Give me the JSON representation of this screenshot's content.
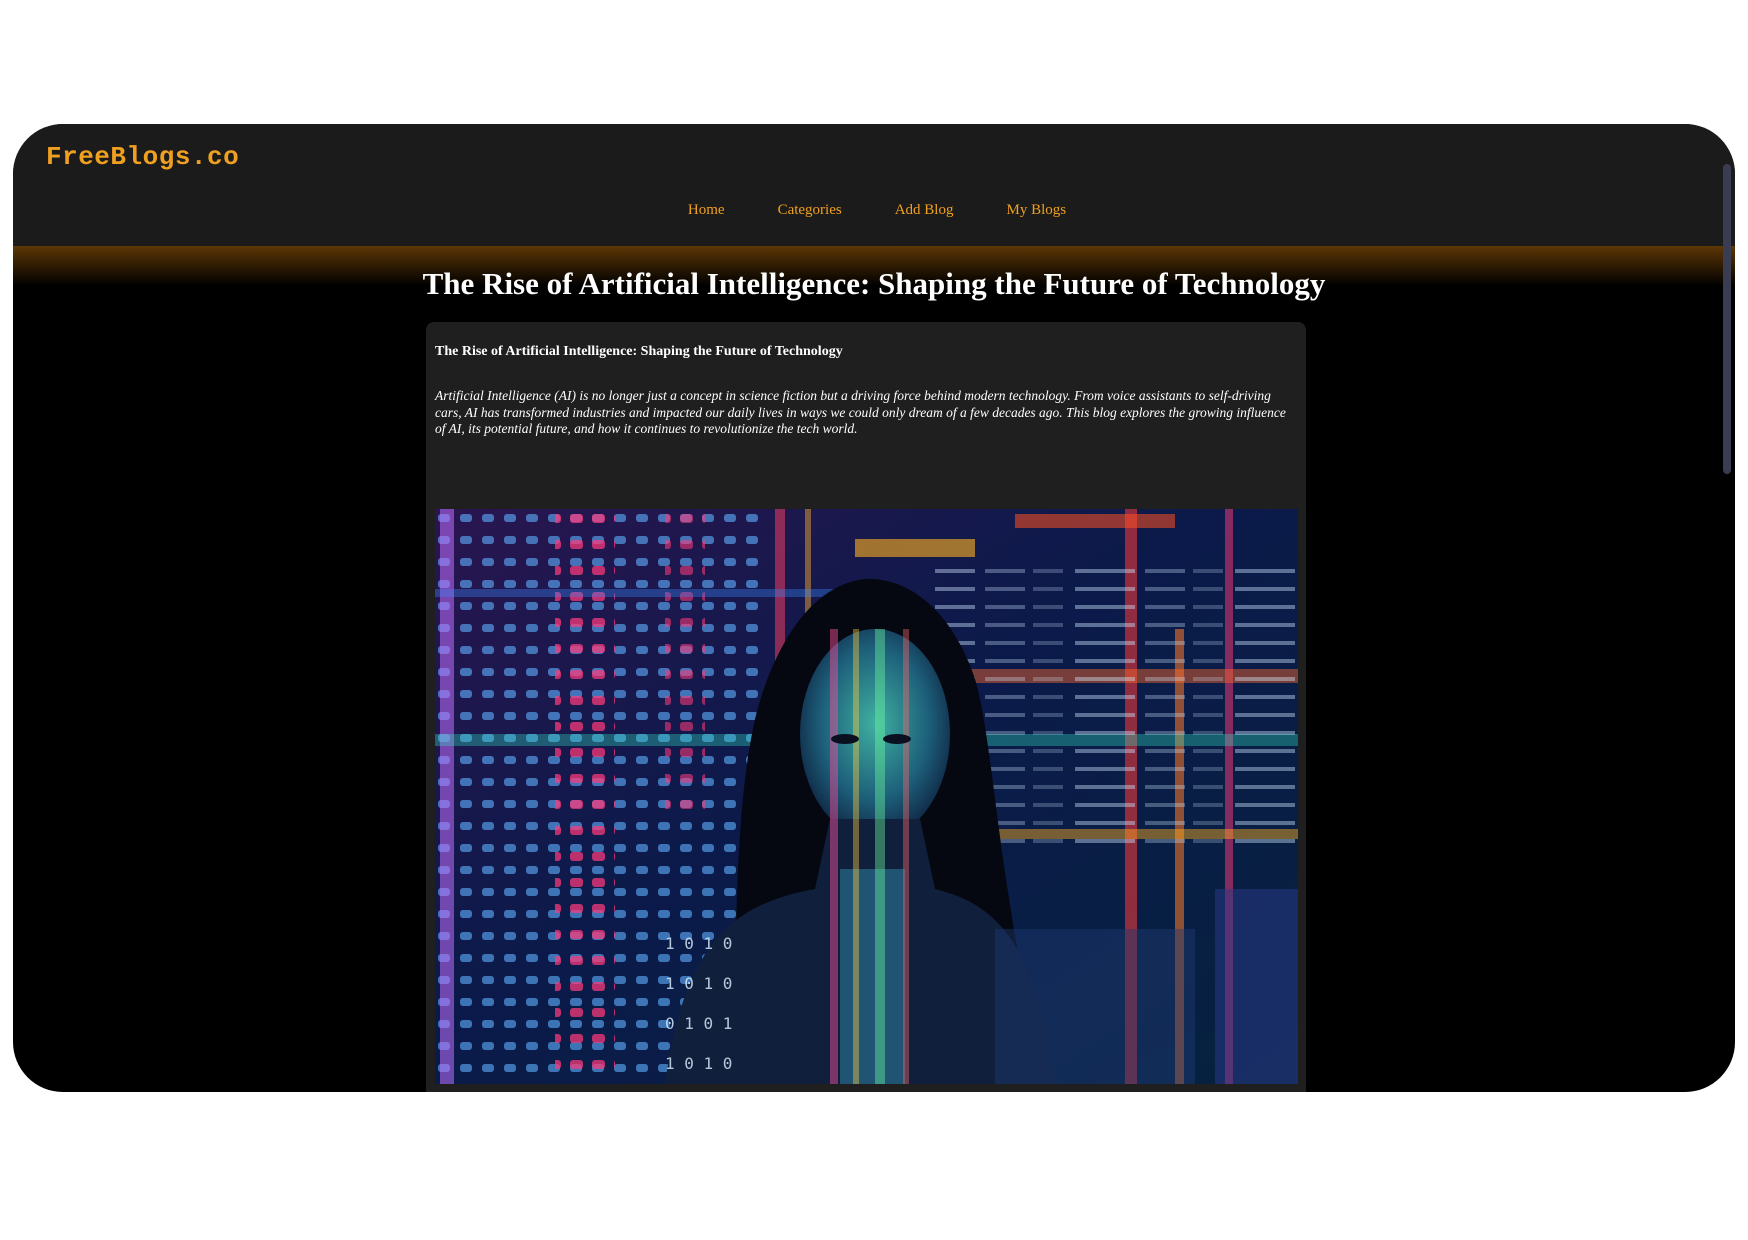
{
  "site": {
    "logo": "FreeBlogs.co"
  },
  "nav": {
    "items": [
      {
        "label": "Home"
      },
      {
        "label": "Categories"
      },
      {
        "label": "Add Blog"
      },
      {
        "label": "My Blogs"
      }
    ]
  },
  "main": {
    "page_title": "The Rise of Artificial Intelligence: Shaping the Future of Technology"
  },
  "post": {
    "title": "The Rise of Artificial Intelligence: Shaping the Future of Technology",
    "excerpt": "Artificial Intelligence (AI) is no longer just a concept in science fiction but a driving force behind modern technology. From voice assistants to self-driving cars, AI has transformed industries and impacted our daily lives in ways we could only dream of a few decades ago. This blog explores the growing influence of AI, its potential future, and how it continues to revolutionize the tech world.",
    "image": {
      "subject": "woman-with-projected-code"
    }
  },
  "colors": {
    "accent": "#f0a020",
    "navbar": "#1b1b1b",
    "page_bg": "#000000",
    "card_bg": "#1f1f1f",
    "text": "#ffffff"
  }
}
